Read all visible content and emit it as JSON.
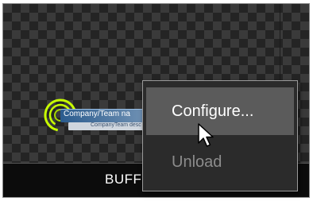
{
  "source": {
    "label": "BUFF"
  },
  "lower_third": {
    "name": "Company/Team na",
    "description": "CompanyTeam desc",
    "accent_color": "#c8ff00"
  },
  "context_menu": {
    "items": [
      {
        "label": "Configure...",
        "state": "hovered"
      },
      {
        "label": "Unload",
        "state": "disabled"
      }
    ]
  },
  "cursor": {
    "icon": "arrow-pointer-icon"
  }
}
